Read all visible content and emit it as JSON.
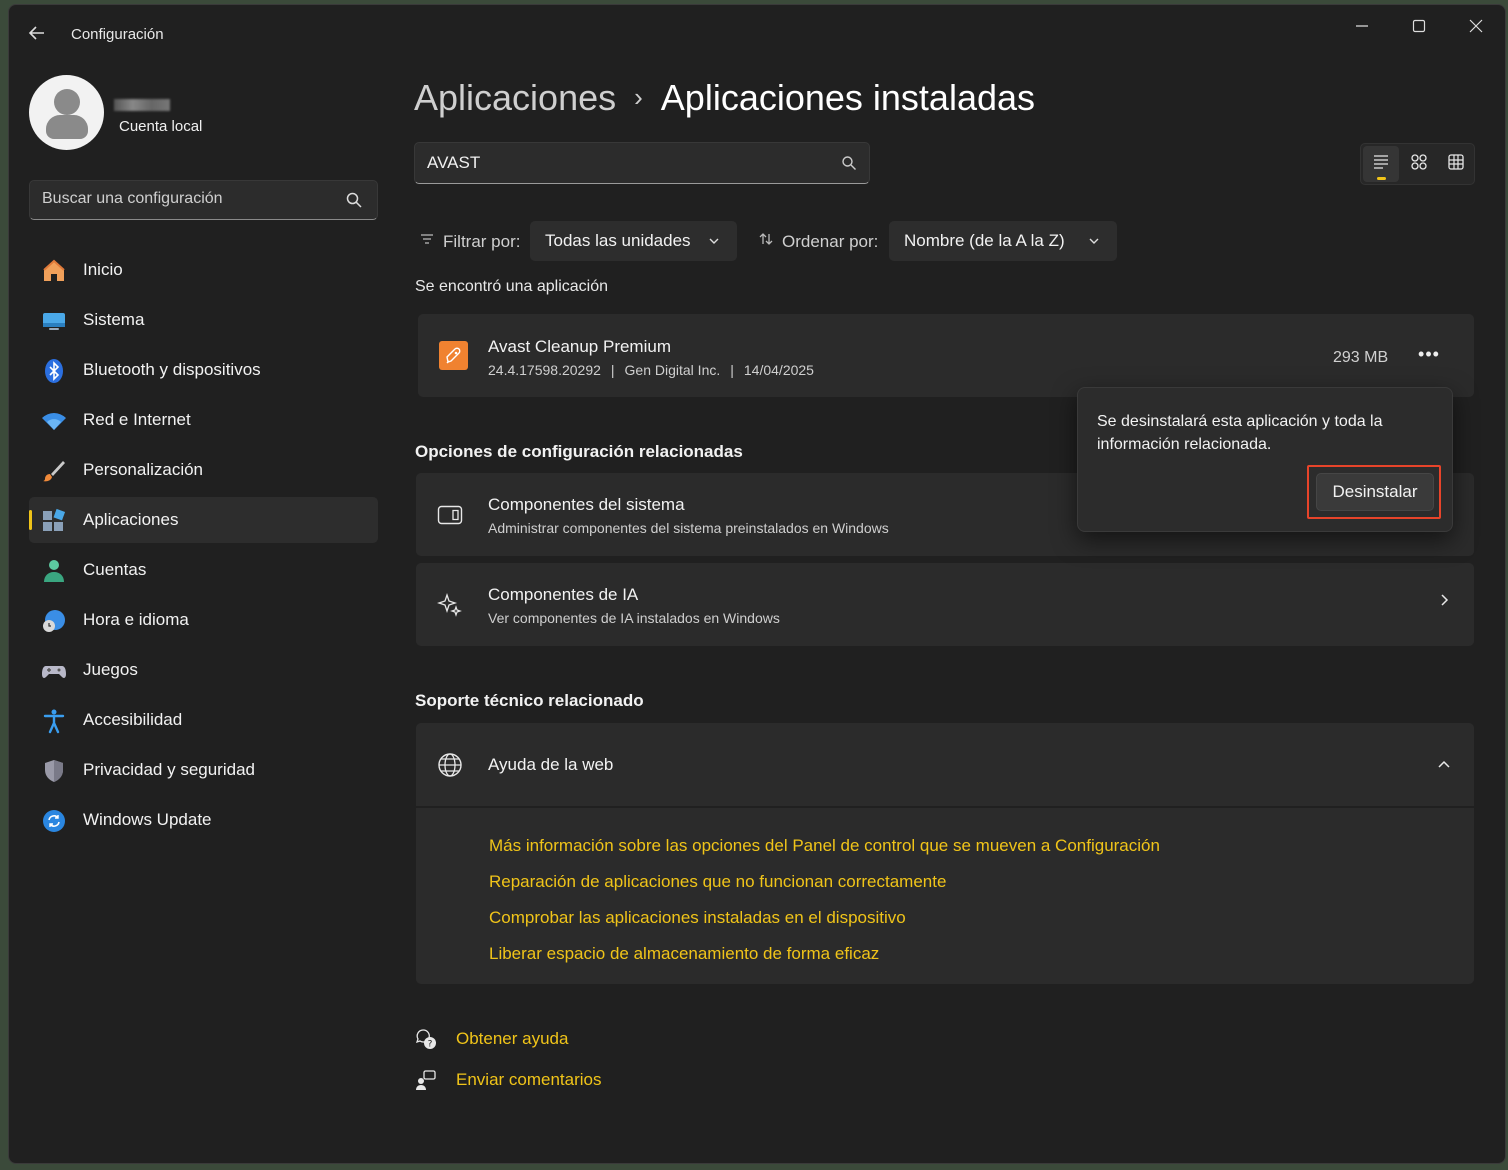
{
  "window": {
    "title": "Configuración",
    "controls": {
      "minimize": "—",
      "maximize": "☐",
      "close": "✕"
    }
  },
  "profile": {
    "account_type": "Cuenta local"
  },
  "sidebar": {
    "search_placeholder": "Buscar una configuración",
    "items": [
      {
        "label": "Inicio",
        "icon": "home-icon"
      },
      {
        "label": "Sistema",
        "icon": "system-icon"
      },
      {
        "label": "Bluetooth y dispositivos",
        "icon": "bluetooth-icon"
      },
      {
        "label": "Red e Internet",
        "icon": "wifi-icon"
      },
      {
        "label": "Personalización",
        "icon": "brush-icon"
      },
      {
        "label": "Aplicaciones",
        "icon": "apps-icon",
        "active": true
      },
      {
        "label": "Cuentas",
        "icon": "person-icon"
      },
      {
        "label": "Hora e idioma",
        "icon": "globe-clock-icon"
      },
      {
        "label": "Juegos",
        "icon": "gamepad-icon"
      },
      {
        "label": "Accesibilidad",
        "icon": "accessibility-icon"
      },
      {
        "label": "Privacidad y seguridad",
        "icon": "shield-icon"
      },
      {
        "label": "Windows Update",
        "icon": "update-icon"
      }
    ]
  },
  "breadcrumb": {
    "parent": "Aplicaciones",
    "separator": "›",
    "current": "Aplicaciones instaladas"
  },
  "search": {
    "value": "AVAST"
  },
  "filters": {
    "filter_label": "Filtrar por:",
    "filter_value": "Todas las unidades",
    "sort_label": "Ordenar por:",
    "sort_value": "Nombre (de la A la Z)"
  },
  "results": {
    "found_text": "Se encontró una aplicación",
    "app": {
      "name": "Avast Cleanup Premium",
      "version": "24.4.17598.20292",
      "publisher": "Gen Digital Inc.",
      "date": "14/04/2025",
      "size": "293 MB",
      "more": "•••",
      "meta_sep": "|"
    }
  },
  "related_settings": {
    "heading": "Opciones de configuración relacionadas",
    "items": [
      {
        "title": "Componentes del sistema",
        "subtitle": "Administrar componentes del sistema preinstalados en Windows"
      },
      {
        "title": "Componentes de IA",
        "subtitle": "Ver componentes de IA instalados en Windows"
      }
    ]
  },
  "support": {
    "heading": "Soporte técnico relacionado",
    "web_help": "Ayuda de la web",
    "links": [
      "Más información sobre las opciones del Panel de control que se mueven a Configuración",
      "Reparación de aplicaciones que no funcionan correctamente",
      "Comprobar las aplicaciones instaladas en el dispositivo",
      "Liberar espacio de almacenamiento de forma eficaz"
    ]
  },
  "footer": {
    "get_help": "Obtener ayuda",
    "send_feedback": "Enviar comentarios"
  },
  "flyout": {
    "message": "Se desinstalará esta aplicación y toda la información relacionada.",
    "button": "Desinstalar"
  },
  "colors": {
    "accent": "#f0c419",
    "background": "#202020",
    "card": "#2b2b2b",
    "highlight": "#e8442a",
    "app_icon": "#f08230"
  }
}
